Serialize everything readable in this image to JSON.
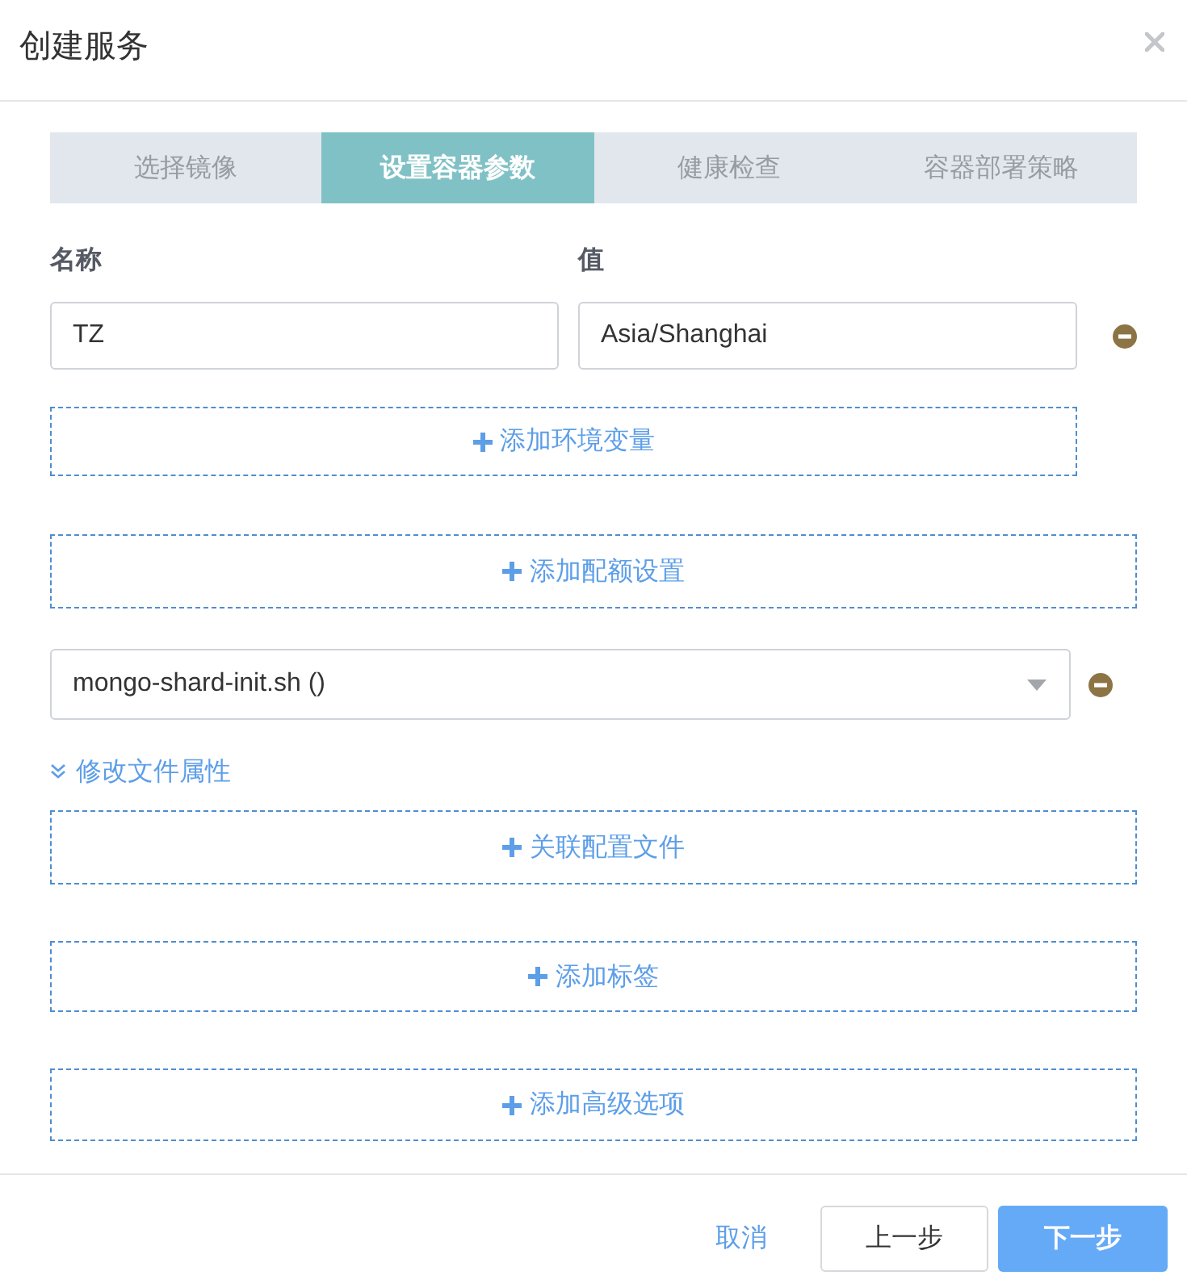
{
  "dialog": {
    "title": "创建服务"
  },
  "steps": [
    {
      "label": "选择镜像",
      "selected": false
    },
    {
      "label": "设置容器参数",
      "selected": true
    },
    {
      "label": "健康检查",
      "selected": false
    },
    {
      "label": "容器部署策略",
      "selected": false
    }
  ],
  "env_vars": {
    "columns": [
      "名称",
      "值"
    ],
    "rows": [
      {
        "name": "TZ",
        "value": "Asia/Shanghai"
      }
    ],
    "add_button": "添加环境变量"
  },
  "quota_button": "添加配额设置",
  "config_files": {
    "items": [
      {
        "file": "mongo-shard-init.sh ()",
        "attributes_link": "修改文件属性"
      }
    ],
    "add_button": "关联配置文件"
  },
  "label_button": "添加标签",
  "advanced_button": "添加高级选项",
  "footer": {
    "cancel": "取消",
    "previous": "上一步",
    "next": "下一步"
  }
}
